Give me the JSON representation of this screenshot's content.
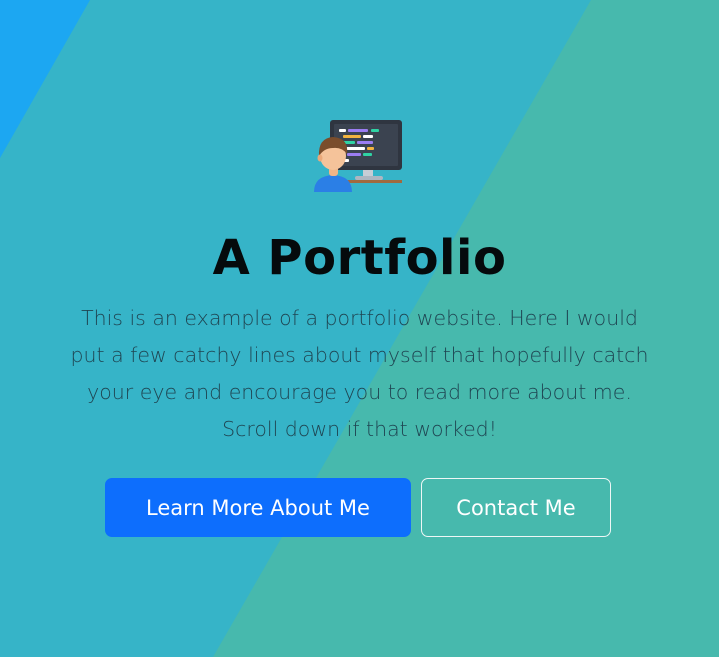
{
  "hero": {
    "icon": "developer-at-computer-icon",
    "title": "A Portfolio",
    "lead_lines": [
      "This is an example of a portfolio website. Here I would",
      "put a few catchy lines about myself that hopefully catch",
      "your eye and encourage you to read more about me.",
      "Scroll down if that worked!"
    ],
    "buttons": {
      "primary_label": "Learn More About Me",
      "secondary_label": "Contact Me"
    }
  },
  "colors": {
    "left_band": "#1ca7f2",
    "middle_band": "#36b4c8",
    "right_band": "#47b9ad",
    "primary_button": "#0d6efd",
    "title_text": "#050a0c",
    "lead_text": "#1f4552"
  }
}
